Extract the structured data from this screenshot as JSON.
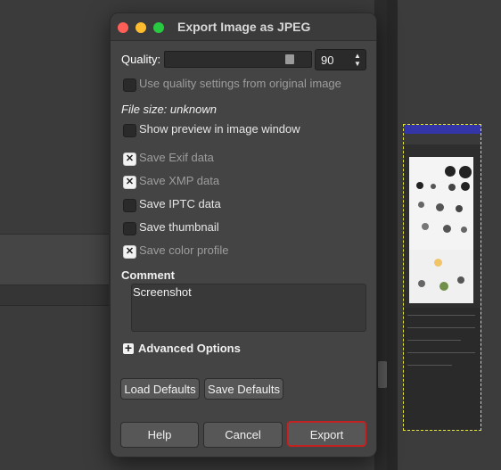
{
  "dialog": {
    "title": "Export Image as JPEG",
    "quality_label": "Quality:",
    "quality_value": "90",
    "quality_fraction": 0.9,
    "use_original_quality_label": "Use quality settings from original image",
    "file_size_label": "File size: unknown",
    "show_preview_label": "Show preview in image window",
    "options": [
      {
        "label": "Save Exif data",
        "checked": true,
        "dimmed": true
      },
      {
        "label": "Save XMP data",
        "checked": true,
        "dimmed": true
      },
      {
        "label": "Save IPTC data",
        "checked": false,
        "dimmed": false
      },
      {
        "label": "Save thumbnail",
        "checked": false,
        "dimmed": false
      },
      {
        "label": "Save color profile",
        "checked": true,
        "dimmed": true
      }
    ],
    "comment_label": "Comment",
    "comment_value": "Screenshot",
    "advanced_label": "Advanced Options",
    "load_defaults_label": "Load Defaults",
    "save_defaults_label": "Save Defaults",
    "help_label": "Help",
    "cancel_label": "Cancel",
    "export_label": "Export"
  },
  "colors": {
    "dialog_bg": "#444444",
    "export_border": "#c22222",
    "close": "#ff5f57",
    "minimize": "#febc2e",
    "maximize": "#28c840"
  }
}
